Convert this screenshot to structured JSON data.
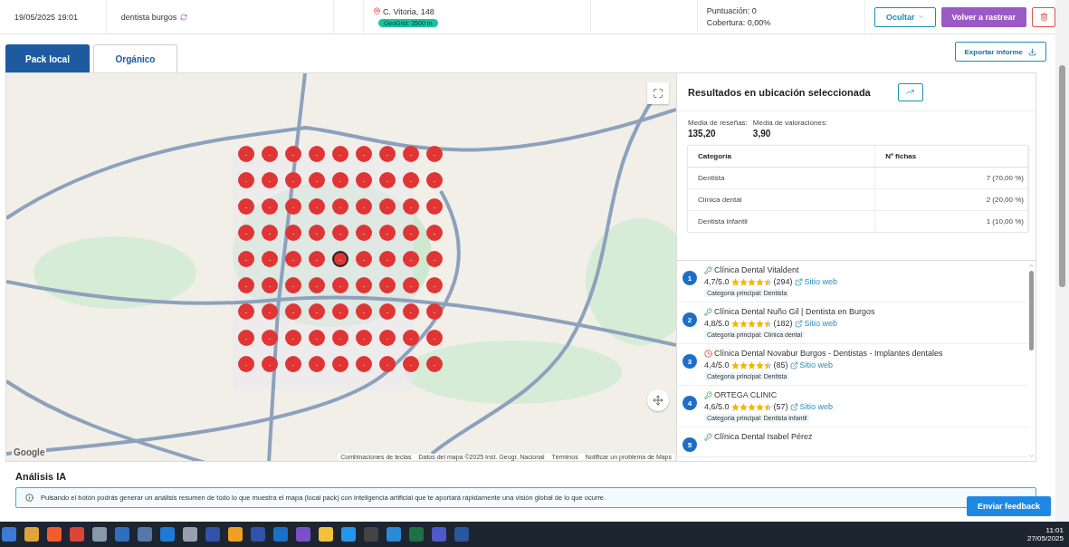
{
  "scan": {
    "date": "19/05/2025 19:01",
    "keyword": "dentista burgos",
    "address": "C. Vitoria, 148",
    "geogrid": "GeoGrid: 3500 m",
    "score": "Puntuación: 0",
    "coverage": "Cobertura: 0,00%"
  },
  "actions": {
    "hide": "Ocultar",
    "rescan": "Volver a rastrear"
  },
  "tabs": [
    {
      "label": "Pack local",
      "selected": true
    },
    {
      "label": "Orgánico",
      "selected": false
    }
  ],
  "export": "Exportar informe",
  "map": {
    "logo": "Google",
    "attribution": [
      "Combinaciones de teclas",
      "Datos del mapa ©2025 Inst. Geogr. Nacional",
      "Términos",
      "Notificar un problema de Maps"
    ],
    "grid": [
      {
        "points": [
          {
            "label": "-",
            "selected": false
          },
          {
            "label": "-",
            "selected": false
          },
          {
            "label": "-",
            "selected": false
          },
          {
            "label": "-",
            "selected": false
          },
          {
            "label": "-",
            "selected": false
          },
          {
            "label": "-",
            "selected": false
          },
          {
            "label": "-",
            "selected": false
          },
          {
            "label": "-",
            "selected": false
          },
          {
            "label": "-",
            "selected": false
          }
        ]
      },
      {
        "points": [
          {
            "label": "-",
            "selected": false
          },
          {
            "label": "-",
            "selected": false
          },
          {
            "label": "-",
            "selected": false
          },
          {
            "label": "-",
            "selected": false
          },
          {
            "label": "-",
            "selected": false
          },
          {
            "label": "-",
            "selected": false
          },
          {
            "label": "-",
            "selected": false
          },
          {
            "label": "-",
            "selected": false
          },
          {
            "label": "-",
            "selected": false
          }
        ]
      },
      {
        "points": [
          {
            "label": "-",
            "selected": false
          },
          {
            "label": "-",
            "selected": false
          },
          {
            "label": "-",
            "selected": false
          },
          {
            "label": "-",
            "selected": false
          },
          {
            "label": "-",
            "selected": false
          },
          {
            "label": "-",
            "selected": false
          },
          {
            "label": "-",
            "selected": false
          },
          {
            "label": "-",
            "selected": false
          },
          {
            "label": "-",
            "selected": false
          }
        ]
      },
      {
        "points": [
          {
            "label": "-",
            "selected": false
          },
          {
            "label": "-",
            "selected": false
          },
          {
            "label": "-",
            "selected": false
          },
          {
            "label": "-",
            "selected": false
          },
          {
            "label": "-",
            "selected": false
          },
          {
            "label": "-",
            "selected": false
          },
          {
            "label": "-",
            "selected": false
          },
          {
            "label": "-",
            "selected": false
          },
          {
            "label": "-",
            "selected": false
          }
        ]
      },
      {
        "points": [
          {
            "label": "-",
            "selected": false
          },
          {
            "label": "-",
            "selected": false
          },
          {
            "label": "-",
            "selected": false
          },
          {
            "label": "-",
            "selected": false
          },
          {
            "label": "-",
            "selected": true
          },
          {
            "label": "-",
            "selected": false
          },
          {
            "label": "-",
            "selected": false
          },
          {
            "label": "-",
            "selected": false
          },
          {
            "label": "-",
            "selected": false
          }
        ]
      },
      {
        "points": [
          {
            "label": "-",
            "selected": false
          },
          {
            "label": "-",
            "selected": false
          },
          {
            "label": "-",
            "selected": false
          },
          {
            "label": "-",
            "selected": false
          },
          {
            "label": "-",
            "selected": false
          },
          {
            "label": "-",
            "selected": false
          },
          {
            "label": "-",
            "selected": false
          },
          {
            "label": "-",
            "selected": false
          },
          {
            "label": "-",
            "selected": false
          }
        ]
      },
      {
        "points": [
          {
            "label": "-",
            "selected": false
          },
          {
            "label": "-",
            "selected": false
          },
          {
            "label": "-",
            "selected": false
          },
          {
            "label": "-",
            "selected": false
          },
          {
            "label": "-",
            "selected": false
          },
          {
            "label": "-",
            "selected": false
          },
          {
            "label": "-",
            "selected": false
          },
          {
            "label": "-",
            "selected": false
          },
          {
            "label": "-",
            "selected": false
          }
        ]
      },
      {
        "points": [
          {
            "label": "-",
            "selected": false
          },
          {
            "label": "-",
            "selected": false
          },
          {
            "label": "-",
            "selected": false
          },
          {
            "label": "-",
            "selected": false
          },
          {
            "label": "-",
            "selected": false
          },
          {
            "label": "-",
            "selected": false
          },
          {
            "label": "-",
            "selected": false
          },
          {
            "label": "-",
            "selected": false
          },
          {
            "label": "-",
            "selected": false
          }
        ]
      },
      {
        "points": [
          {
            "label": "-",
            "selected": false
          },
          {
            "label": "-",
            "selected": false
          },
          {
            "label": "-",
            "selected": false
          },
          {
            "label": "-",
            "selected": false
          },
          {
            "label": "-",
            "selected": false
          },
          {
            "label": "-",
            "selected": false
          },
          {
            "label": "-",
            "selected": false
          },
          {
            "label": "-",
            "selected": false
          },
          {
            "label": "-",
            "selected": false
          }
        ]
      }
    ]
  },
  "results": {
    "title": "Resultados en ubicación seleccionada",
    "stats": [
      {
        "label": "Media de reseñas:",
        "value": "135,20"
      },
      {
        "label": "Media de valoraciones:",
        "value": "3,90"
      }
    ],
    "table": {
      "columns": [
        "Categoría",
        "Nº fichas"
      ],
      "rows": [
        [
          "Dentista",
          "7 (70,00 %)"
        ],
        [
          "Clínica dental",
          "2 (20,00 %)"
        ],
        [
          "Dentista infantil",
          "1 (10,00 %)"
        ]
      ]
    },
    "listings": [
      {
        "rank": "1",
        "kind": "verified",
        "name": "Clínica Dental Vitaldent",
        "rating": "4,7/5.0",
        "stars": 4.5,
        "reviews": "(294)",
        "link": "Sitio web",
        "category": "Categoría principal: Dentista"
      },
      {
        "rank": "2",
        "kind": "verified",
        "name": "Clínica Dental Nuño Gil | Dentista en Burgos",
        "rating": "4,8/5.0",
        "stars": 4.5,
        "reviews": "(182)",
        "link": "Sitio web",
        "category": "Categoría principal: Clínica dental"
      },
      {
        "rank": "3",
        "kind": "alert",
        "name": "Clínica Dental Novabur Burgos - Dentistas - Implantes dentales",
        "rating": "4,4/5.0",
        "stars": 4.5,
        "reviews": "(85)",
        "link": "Sitio web",
        "category": "Categoría principal: Dentista"
      },
      {
        "rank": "4",
        "kind": "verified",
        "name": "ORTEGA CLINIC",
        "rating": "4,6/5.0",
        "stars": 4.5,
        "reviews": "(57)",
        "link": "Sitio web",
        "category": "Categoría principal: Dentista infantil"
      },
      {
        "rank": "5",
        "kind": "verified",
        "name": "Clínica Dental Isabel Pérez"
      }
    ]
  },
  "analysis": {
    "title": "Análisis IA",
    "info": "Pulsando el botón podrás generar un análisis resumen de todo lo que muestra el mapa (local pack) con inteligencia artificial que te aportará rápidamente una visión global de lo que ocurre."
  },
  "feedback": "Enviar feedback",
  "taskbar": {
    "time": "11:01",
    "date": "27/05/2025"
  }
}
